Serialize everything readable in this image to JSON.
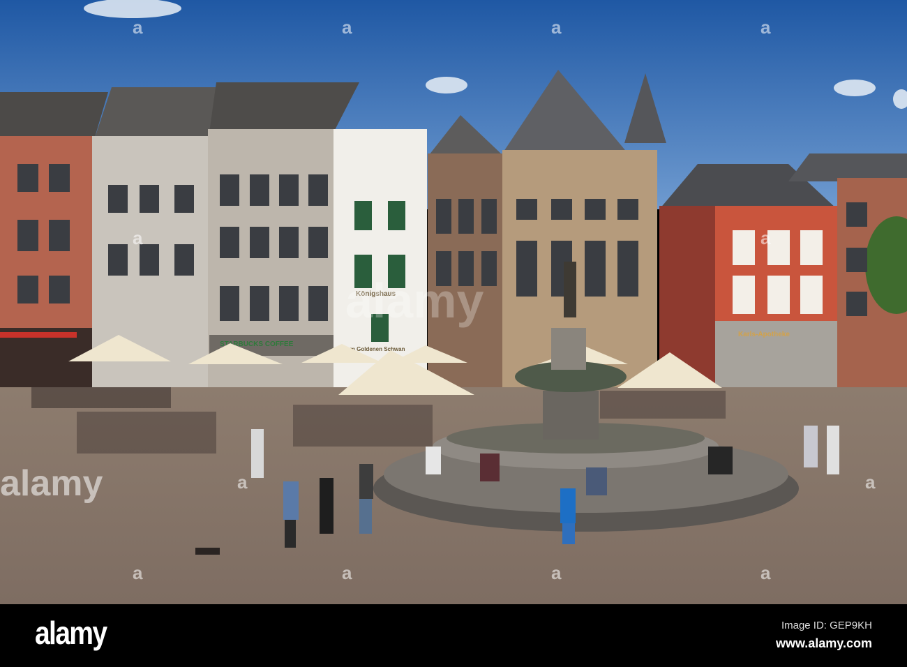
{
  "photo": {
    "subject": "Market square with fountain",
    "signs": {
      "starbucks": "STARBUCKS COFFEE",
      "koenigshaus": "Königshaus",
      "goldener_schwan": "Zum Goldenen Schwan",
      "apotheke": "Karls-Apotheke"
    }
  },
  "watermark": {
    "large": "alamy",
    "small": "a"
  },
  "footer": {
    "logo": "alamy",
    "image_id": "Image ID: GEP9KH",
    "website": "www.alamy.com"
  },
  "colors": {
    "sky": "#2a64ae",
    "plaza": "#8b7b6f",
    "footer": "#000000"
  }
}
